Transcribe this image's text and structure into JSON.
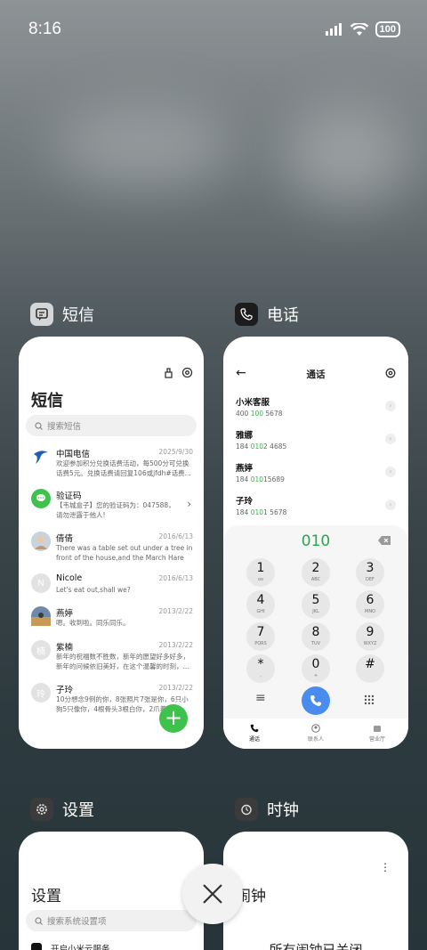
{
  "status": {
    "time": "8:16",
    "battery": "100"
  },
  "apps": {
    "sms": {
      "label": "短信",
      "title": "短信",
      "search_placeholder": "搜索短信",
      "messages": [
        {
          "name": "中国电信",
          "date": "2025/9/30",
          "body": "欢迎参加积分兑换话费活动，每500分可兑换话费5元。兑换话费请回复106或jfdh#话费..."
        },
        {
          "name": "验证码",
          "date": "",
          "body": "【韦城盒子】您的验证码为：047588，请勿泄露于他人!"
        },
        {
          "name": "倩倩",
          "date": "2016/6/13",
          "body": "There was a table set out under a tree in front of the house,and the March Hare an..."
        },
        {
          "name": "Nicole",
          "date": "2016/6/13",
          "body": "Let's eat out,shall we?",
          "initial": "N"
        },
        {
          "name": "燕婷",
          "date": "2013/2/22",
          "body": "嗯。收到啦。同乐同乐。"
        },
        {
          "name": "紫楠",
          "date": "2013/2/22",
          "body": "新年的祝福数不胜数，新年的愿望好多好多，新年的问候依旧美好，在这个温馨的时刻，...",
          "initial": "楠"
        },
        {
          "name": "子玲",
          "date": "2013/2/22",
          "body": "10分想念9例的你，8张照片7张是你，6只小狗5只像你，4根骨头3根白你，2爪着1...",
          "initial": "玲"
        }
      ],
      "fab": "+"
    },
    "phone": {
      "label": "电话",
      "title": "通话",
      "contacts": [
        {
          "name": "小米客服",
          "num_a": "400 ",
          "num_g": "100",
          "num_b": " 5678"
        },
        {
          "name": "雅娜",
          "num_a": "184 ",
          "num_g": "010",
          "num_b": "2 4685"
        },
        {
          "name": "燕婷",
          "num_a": "184 ",
          "num_g": "010",
          "num_b": "15689"
        },
        {
          "name": "子玲",
          "num_a": "184 ",
          "num_g": "010",
          "num_b": "1 5678"
        }
      ],
      "dialed": "010",
      "keys": [
        {
          "d": "1",
          "s": "oo"
        },
        {
          "d": "2",
          "s": "ABC"
        },
        {
          "d": "3",
          "s": "DEF"
        },
        {
          "d": "4",
          "s": "GHI"
        },
        {
          "d": "5",
          "s": "JKL"
        },
        {
          "d": "6",
          "s": "MNO"
        },
        {
          "d": "7",
          "s": "PQRS"
        },
        {
          "d": "8",
          "s": "TUV"
        },
        {
          "d": "9",
          "s": "WXYZ"
        },
        {
          "d": "*",
          "s": ","
        },
        {
          "d": "0",
          "s": "+"
        },
        {
          "d": "#",
          "s": ""
        }
      ],
      "tabs": {
        "calls": "通话",
        "contacts": "联系人",
        "store": "营业厅"
      }
    },
    "settings": {
      "label": "设置",
      "title": "设置",
      "search_placeholder": "搜索系统设置项",
      "first_item": "开启小米云服务"
    },
    "clock": {
      "label": "时钟",
      "title": "闹钟",
      "empty_text": "所有闹钟已关闭"
    }
  }
}
